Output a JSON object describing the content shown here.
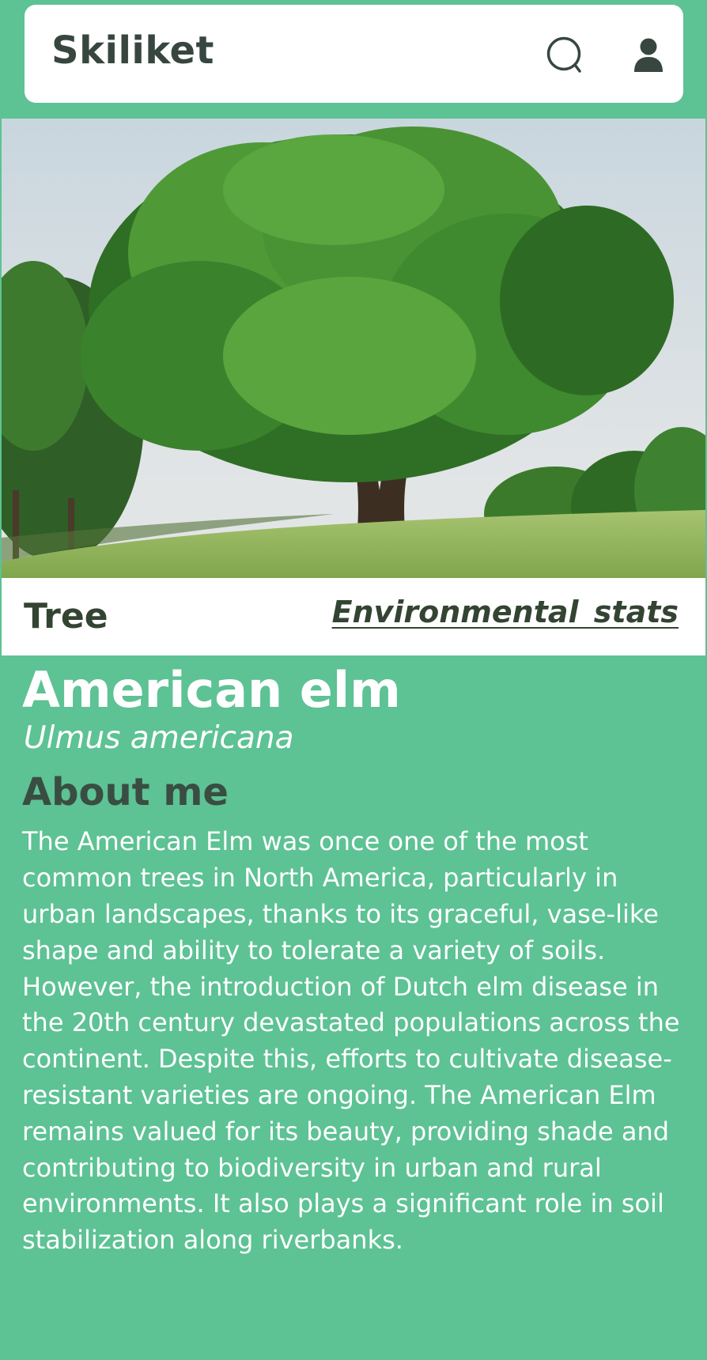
{
  "header": {
    "app_title": "Skiliket",
    "search_icon": "search-icon",
    "user_icon": "user-icon"
  },
  "hero": {
    "image": "tree-photo"
  },
  "info_strip": {
    "category": "Tree",
    "stats_link": "Environmental  stats"
  },
  "species": {
    "common_name": "American elm",
    "latin_name": "Ulmus americana"
  },
  "about": {
    "heading": "About me",
    "text": "The American Elm was once one of the most common trees in North America, particularly in urban landscapes, thanks to its graceful, vase-like shape and ability to tolerate a variety of soils. However, the introduction of Dutch elm disease in the 20th century devastated populations across the continent. Despite this, efforts to cultivate disease-resistant varieties are ongoing. The American Elm remains valued for its beauty, providing shade and contributing to biodiversity in urban and rural environments. It also plays a significant role in soil stabilization along riverbanks."
  },
  "colors": {
    "background": "#5dc294",
    "header_bg": "#ffffff",
    "dark_text": "#344433",
    "heading_text": "#3a4d42"
  }
}
